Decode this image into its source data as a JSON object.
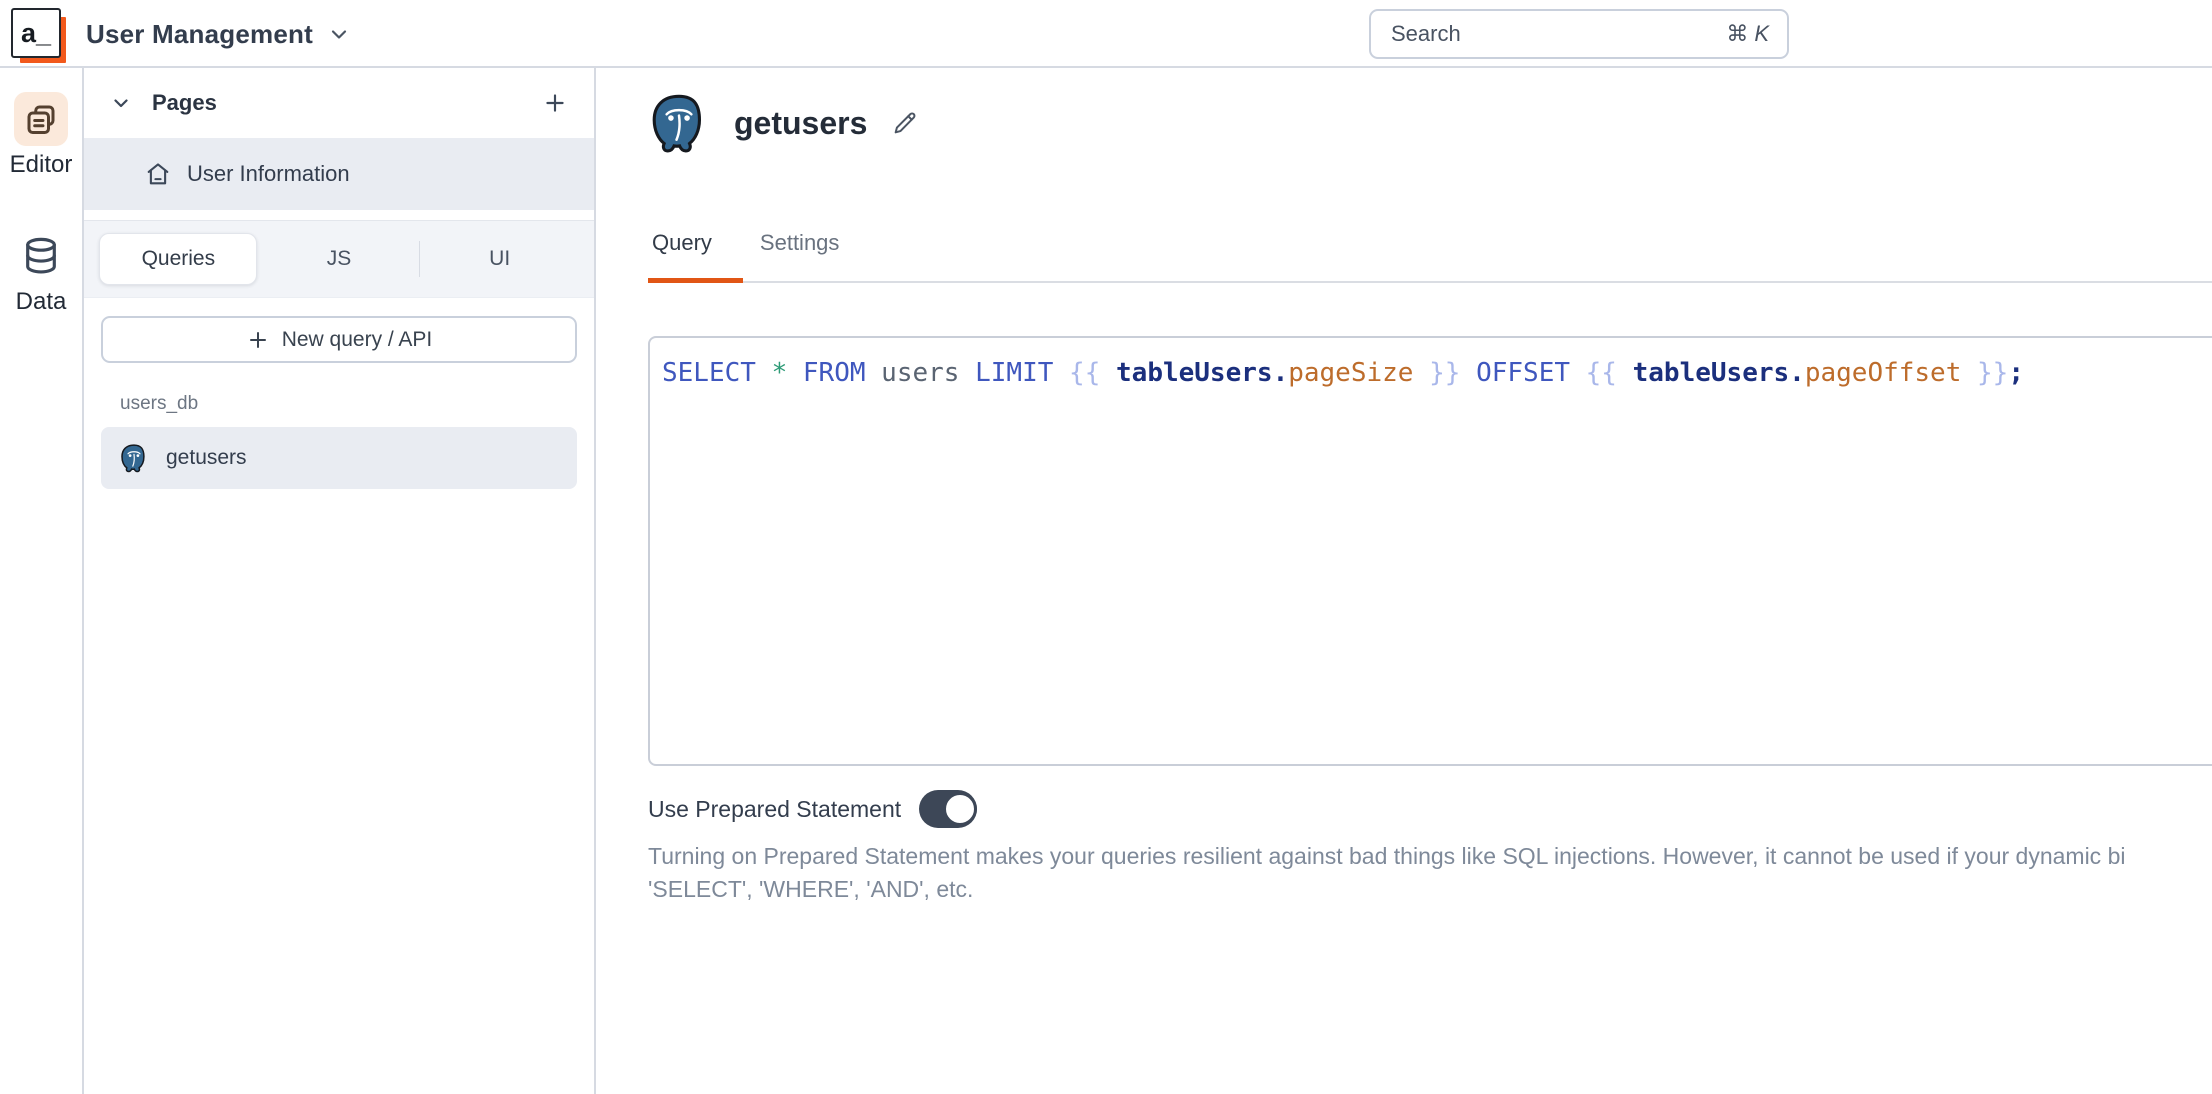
{
  "topbar": {
    "logo_text": "a_",
    "app_title": "User Management",
    "search": {
      "placeholder": "Search",
      "shortcut_mod": "⌘",
      "shortcut_key": "K"
    }
  },
  "rail": {
    "editor_label": "Editor",
    "data_label": "Data"
  },
  "sidebar": {
    "pages_header": "Pages",
    "pages": [
      {
        "label": "User Information",
        "selected": true
      }
    ],
    "tabs": [
      {
        "label": "Queries",
        "active": true
      },
      {
        "label": "JS",
        "active": false
      },
      {
        "label": "UI",
        "active": false
      }
    ],
    "new_query_label": "New query / API",
    "groups": [
      {
        "datasource": "users_db",
        "queries": [
          {
            "label": "getusers",
            "selected": true
          }
        ]
      }
    ]
  },
  "main": {
    "query_name": "getusers",
    "tabs": [
      {
        "label": "Query",
        "active": true
      },
      {
        "label": "Settings",
        "active": false
      }
    ],
    "sql_plain": "SELECT * FROM users LIMIT {{ tableUsers.pageSize }} OFFSET {{ tableUsers.pageOffset }};",
    "sql_tokens": [
      {
        "text": "SELECT",
        "type": "keyword"
      },
      {
        "text": " ",
        "type": "plain"
      },
      {
        "text": "*",
        "type": "star"
      },
      {
        "text": " ",
        "type": "plain"
      },
      {
        "text": "FROM",
        "type": "keyword"
      },
      {
        "text": " ",
        "type": "plain"
      },
      {
        "text": "users",
        "type": "ident"
      },
      {
        "text": " ",
        "type": "plain"
      },
      {
        "text": "LIMIT",
        "type": "keyword"
      },
      {
        "text": " ",
        "type": "plain"
      },
      {
        "text": "{{",
        "type": "brace"
      },
      {
        "text": " ",
        "type": "plain"
      },
      {
        "text": "tableUsers",
        "type": "object"
      },
      {
        "text": ".",
        "type": "dot"
      },
      {
        "text": "pageSize",
        "type": "prop"
      },
      {
        "text": " ",
        "type": "plain"
      },
      {
        "text": "}}",
        "type": "brace"
      },
      {
        "text": " ",
        "type": "plain"
      },
      {
        "text": "OFFSET",
        "type": "keyword"
      },
      {
        "text": " ",
        "type": "plain"
      },
      {
        "text": "{{",
        "type": "brace"
      },
      {
        "text": " ",
        "type": "plain"
      },
      {
        "text": "tableUsers",
        "type": "object"
      },
      {
        "text": ".",
        "type": "dot"
      },
      {
        "text": "pageOffset",
        "type": "prop"
      },
      {
        "text": " ",
        "type": "plain"
      },
      {
        "text": "}}",
        "type": "brace"
      },
      {
        "text": ";",
        "type": "semi"
      }
    ],
    "prepared_statement": {
      "label": "Use Prepared Statement",
      "enabled": true,
      "help_line1": "Turning on Prepared Statement makes your queries resilient against bad things like SQL injections. However, it cannot be used if your dynamic bi",
      "help_line2": "'SELECT', 'WHERE', 'AND', etc."
    }
  },
  "colors": {
    "accent": "#E15615",
    "postgres_blue": "#336791",
    "selected_item_bg": "#E9ECF2",
    "toggle_on": "#3D4757",
    "syntax": {
      "keyword": "#3F57BE",
      "star": "#2E9B77",
      "identifier": "#5A6472",
      "brace": "#A9B7EA",
      "object": "#1B2F7D",
      "property": "#BD6C2B",
      "semicolon": "#1B2F7D"
    }
  }
}
